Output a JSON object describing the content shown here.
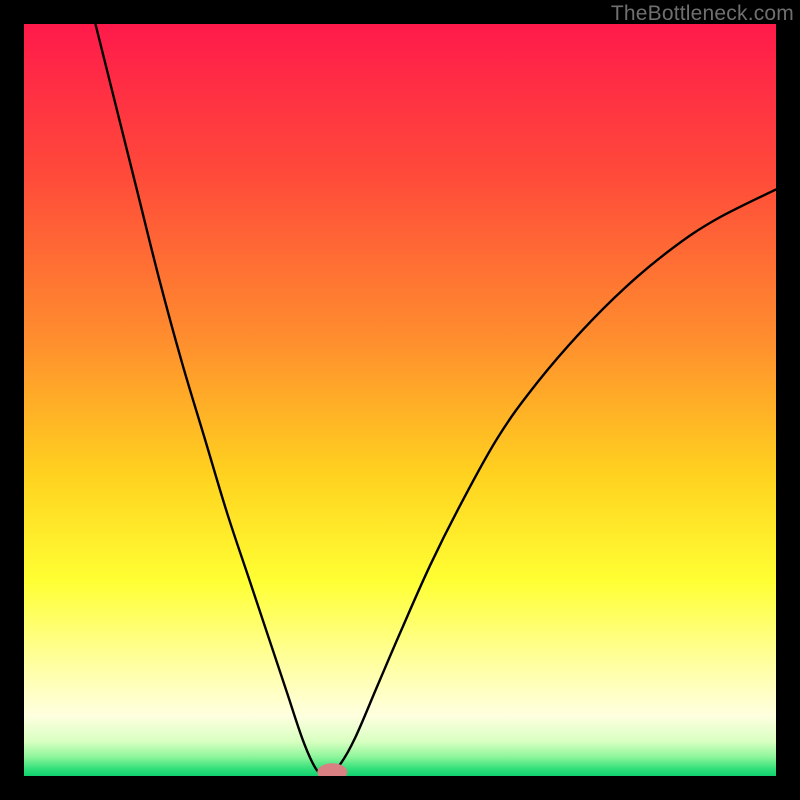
{
  "watermark": "TheBottleneck.com",
  "chart_data": {
    "type": "line",
    "title": "",
    "xlabel": "",
    "ylabel": "",
    "xlim": [
      0,
      100
    ],
    "ylim": [
      0,
      100
    ],
    "gradient_stops": [
      {
        "offset": 0.0,
        "color": "#ff1a4b"
      },
      {
        "offset": 0.2,
        "color": "#ff4a3a"
      },
      {
        "offset": 0.42,
        "color": "#ff8e2e"
      },
      {
        "offset": 0.6,
        "color": "#ffd21f"
      },
      {
        "offset": 0.74,
        "color": "#ffff33"
      },
      {
        "offset": 0.85,
        "color": "#ffffa0"
      },
      {
        "offset": 0.92,
        "color": "#ffffe0"
      },
      {
        "offset": 0.955,
        "color": "#d7ffc0"
      },
      {
        "offset": 0.975,
        "color": "#8cf59a"
      },
      {
        "offset": 0.99,
        "color": "#34e07a"
      },
      {
        "offset": 1.0,
        "color": "#10d070"
      }
    ],
    "vertex": {
      "x": 40,
      "y": 0
    },
    "marker": {
      "x": 41,
      "y": 0.5,
      "color": "#d98083",
      "rx": 2.0,
      "ry": 1.2
    },
    "series": [
      {
        "name": "curve",
        "points": [
          {
            "x": 9.5,
            "y": 100
          },
          {
            "x": 12,
            "y": 90
          },
          {
            "x": 15,
            "y": 78
          },
          {
            "x": 18,
            "y": 66
          },
          {
            "x": 21,
            "y": 55
          },
          {
            "x": 24,
            "y": 45
          },
          {
            "x": 27,
            "y": 35
          },
          {
            "x": 30,
            "y": 26
          },
          {
            "x": 33,
            "y": 17
          },
          {
            "x": 35,
            "y": 11
          },
          {
            "x": 37,
            "y": 5
          },
          {
            "x": 38.5,
            "y": 1.5
          },
          {
            "x": 39.5,
            "y": 0.3
          },
          {
            "x": 40.5,
            "y": 0.3
          },
          {
            "x": 42,
            "y": 1.5
          },
          {
            "x": 44,
            "y": 5
          },
          {
            "x": 47,
            "y": 12
          },
          {
            "x": 50,
            "y": 19
          },
          {
            "x": 54,
            "y": 28
          },
          {
            "x": 58,
            "y": 36
          },
          {
            "x": 63,
            "y": 45
          },
          {
            "x": 68,
            "y": 52
          },
          {
            "x": 74,
            "y": 59
          },
          {
            "x": 80,
            "y": 65
          },
          {
            "x": 86,
            "y": 70
          },
          {
            "x": 92,
            "y": 74
          },
          {
            "x": 100,
            "y": 78
          }
        ]
      }
    ]
  }
}
